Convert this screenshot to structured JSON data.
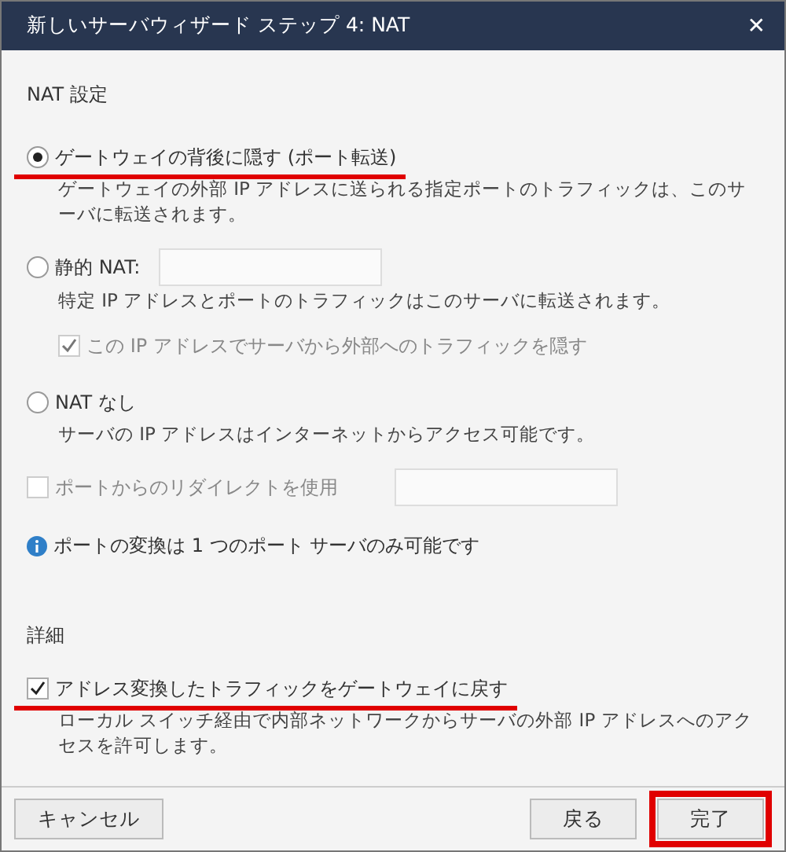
{
  "window": {
    "title": "新しいサーバウィザード ステップ 4: NAT",
    "close": "✕"
  },
  "nat_settings": {
    "heading": "NAT 設定",
    "items": [
      {
        "kind": "radio",
        "label": "ゲートウェイの背後に隠す (ポート転送)",
        "selected": true,
        "highlighted": true,
        "description": "ゲートウェイの外部 IP アドレスに送られる指定ポートのトラフィックは、このサーバに転送されます。"
      },
      {
        "kind": "radio_field",
        "label": "静的 NAT:",
        "selected": false,
        "description": "特定 IP アドレスとポートのトラフィックはこのサーバに転送されます。"
      },
      {
        "kind": "subcheckbox",
        "label": "この IP アドレスでサーバから外部へのトラフィックを隠す",
        "checked": true,
        "disabled": true
      },
      {
        "kind": "radio",
        "label": "NAT なし",
        "selected": false,
        "description": "サーバの IP アドレスはインターネットからアクセス可能です。"
      },
      {
        "kind": "checkbox_field",
        "label": "ポートからのリダイレクトを使用",
        "checked": false,
        "disabled": true
      },
      {
        "kind": "info",
        "label": "ポートの変換は 1 つのポート サーバのみ可能です"
      }
    ]
  },
  "details": {
    "heading": "詳細",
    "items": [
      {
        "kind": "checkbox",
        "label": "アドレス変換したトラフィックをゲートウェイに戻す",
        "checked": true,
        "disabled": false,
        "highlighted": true,
        "description": "ローカル スイッチ経由で内部ネットワークからサーバの外部 IP アドレスへのアクセスを許可します。"
      }
    ]
  },
  "footer": {
    "left": [
      {
        "label": "キャンセル"
      }
    ],
    "right": [
      {
        "label": "戻る"
      },
      {
        "label": "完了",
        "highlighted": true
      }
    ]
  }
}
